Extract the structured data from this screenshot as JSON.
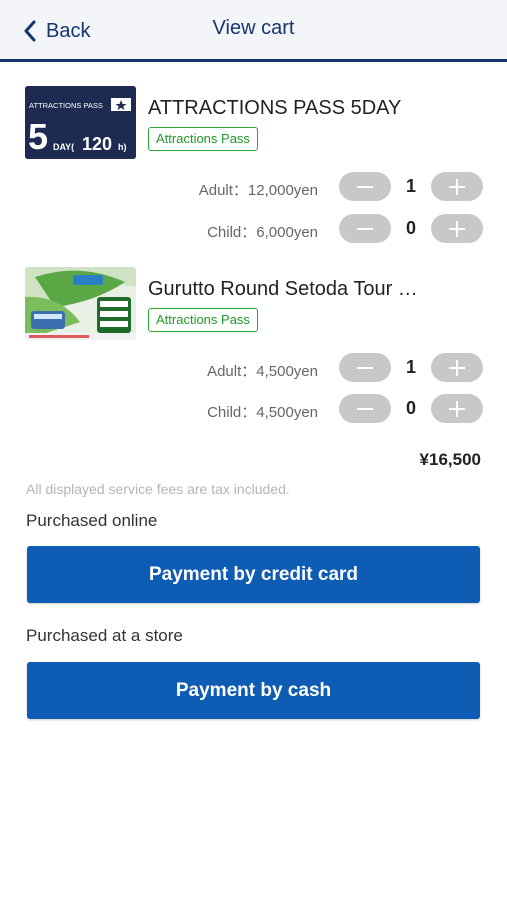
{
  "nav": {
    "back_label": "Back",
    "title": "View cart"
  },
  "items": [
    {
      "title": "ATTRACTIONS PASS 5DAY",
      "tag": "Attractions Pass",
      "thumb": {
        "header": "ATTRACTIONS PASS",
        "big": "5",
        "day": "DAY(",
        "hours": "120",
        "h": "h)"
      },
      "rows": [
        {
          "label": "Adult：12,000yen",
          "qty": "1"
        },
        {
          "label": "Child：6,000yen",
          "qty": "0"
        }
      ]
    },
    {
      "title": "Gurutto Round Setoda Tour …",
      "tag": "Attractions Pass",
      "rows": [
        {
          "label": "Adult：4,500yen",
          "qty": "1"
        },
        {
          "label": "Child：4,500yen",
          "qty": "0"
        }
      ]
    }
  ],
  "total": "¥16,500",
  "tax_note": "All displayed service fees are tax included.",
  "online": {
    "label": "Purchased online",
    "button": "Payment by credit card"
  },
  "store": {
    "label": "Purchased at a store",
    "button": "Payment by cash"
  },
  "colors": {
    "navy": "#14356e",
    "brand_blue": "#0f5cb4",
    "tag_green": "#2aa834",
    "stepper_gray": "#c8c8c8"
  }
}
